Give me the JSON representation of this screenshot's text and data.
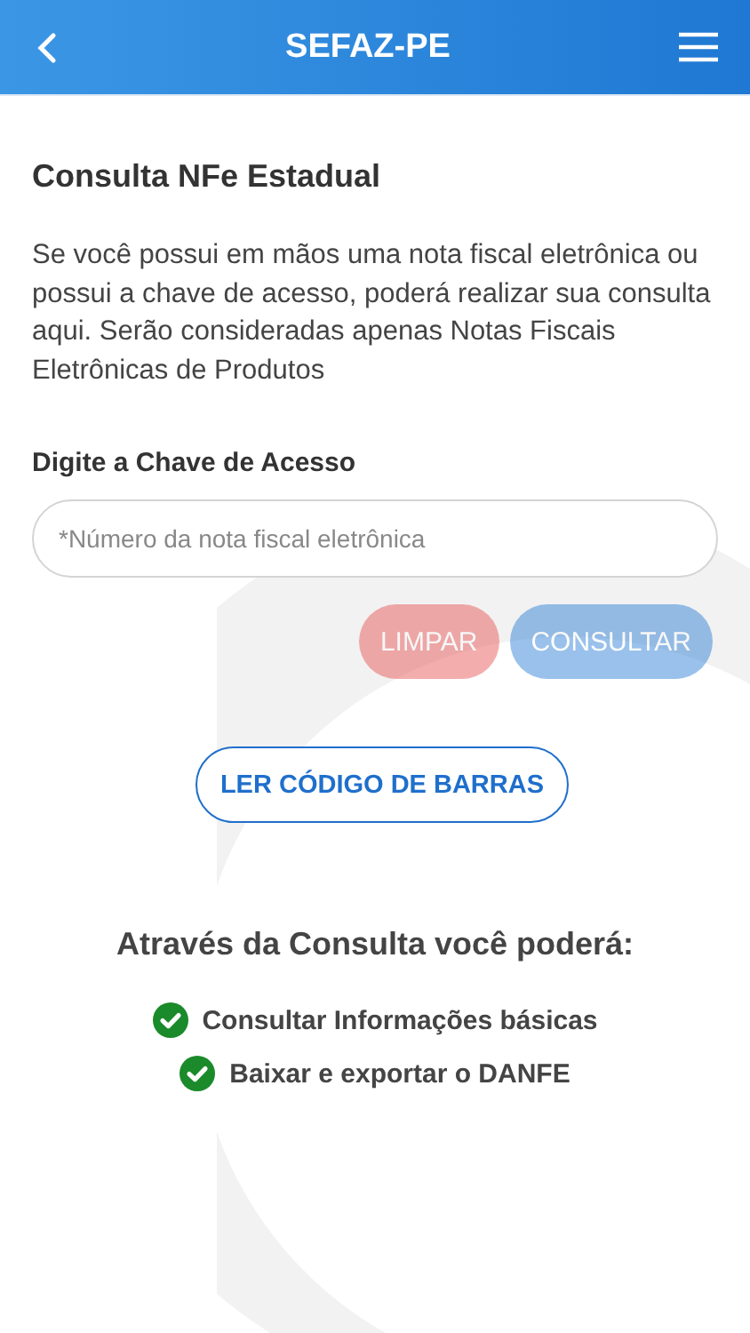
{
  "header": {
    "title": "SEFAZ-PE"
  },
  "page": {
    "title": "Consulta NFe Estadual",
    "description": "Se você possui em mãos uma nota fiscal eletrônica ou possui a chave de acesso, poderá realizar sua consulta aqui. Serão consideradas apenas Notas Fiscais Eletrônicas de Produtos"
  },
  "access_key": {
    "label": "Digite a Chave de Acesso",
    "placeholder": "*Número da nota fiscal eletrônica"
  },
  "actions": [
    {
      "kind": "clear",
      "label": "LIMPAR",
      "disabled": true
    },
    {
      "kind": "submit",
      "label": "CONSULTAR",
      "disabled": true
    }
  ],
  "scan_button": {
    "label": "LER CÓDIGO DE BARRAS"
  },
  "features": {
    "title": "Através da Consulta você poderá:",
    "items": [
      {
        "label": "Consultar Informações básicas",
        "checked": true
      },
      {
        "label": "Baixar e exportar o DANFE",
        "checked": true
      }
    ]
  }
}
